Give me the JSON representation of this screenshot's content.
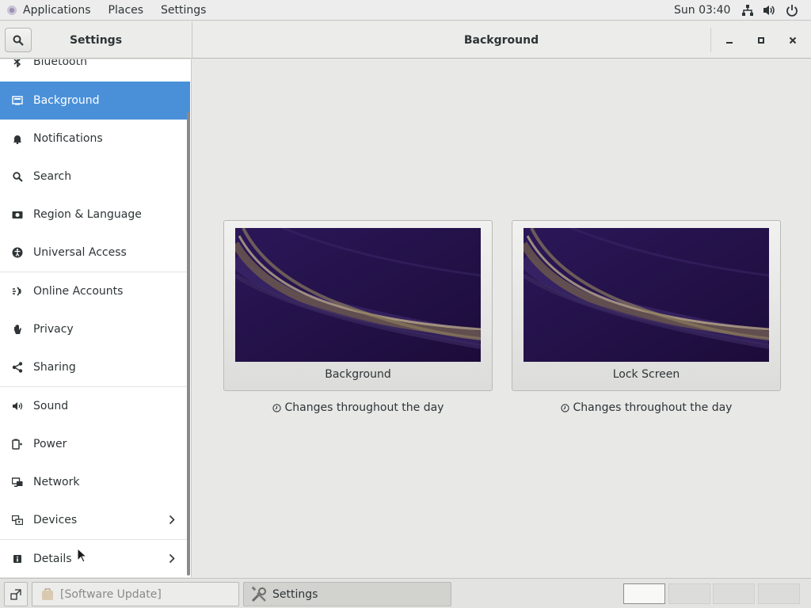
{
  "topbar": {
    "applications": "Applications",
    "places": "Places",
    "settings": "Settings",
    "clock": "Sun 03:40",
    "tray_icons": [
      "network-icon",
      "volume-icon",
      "power-icon"
    ]
  },
  "header": {
    "left_title": "Settings",
    "title": "Background"
  },
  "sidebar": {
    "items": [
      {
        "label": "Bluetooth",
        "icon": "bluetooth-icon"
      },
      {
        "label": "Background",
        "icon": "display-icon",
        "active": true
      },
      {
        "label": "Notifications",
        "icon": "bell-icon"
      },
      {
        "label": "Search",
        "icon": "search-icon"
      },
      {
        "label": "Region & Language",
        "icon": "camera-icon"
      },
      {
        "label": "Universal Access",
        "icon": "accessibility-icon"
      },
      {
        "label": "Online Accounts",
        "icon": "online-accounts-icon"
      },
      {
        "label": "Privacy",
        "icon": "hand-icon"
      },
      {
        "label": "Sharing",
        "icon": "share-icon"
      },
      {
        "label": "Sound",
        "icon": "speaker-icon"
      },
      {
        "label": "Power",
        "icon": "battery-icon"
      },
      {
        "label": "Network",
        "icon": "network-icon"
      },
      {
        "label": "Devices",
        "icon": "devices-icon",
        "has_submenu": true
      },
      {
        "label": "Details",
        "icon": "info-icon",
        "has_submenu": true
      }
    ]
  },
  "content": {
    "cards": [
      {
        "label": "Background",
        "note": "Changes throughout the day"
      },
      {
        "label": "Lock Screen",
        "note": "Changes throughout the day"
      }
    ]
  },
  "taskbar": {
    "tasks": [
      {
        "label": "[Software Update]",
        "state": "inactive"
      },
      {
        "label": "Settings",
        "state": "active"
      }
    ],
    "workspaces": 4,
    "current_workspace": 1
  },
  "colors": {
    "accent": "#4a90d9",
    "wallpaper_base": "#2a1650"
  }
}
